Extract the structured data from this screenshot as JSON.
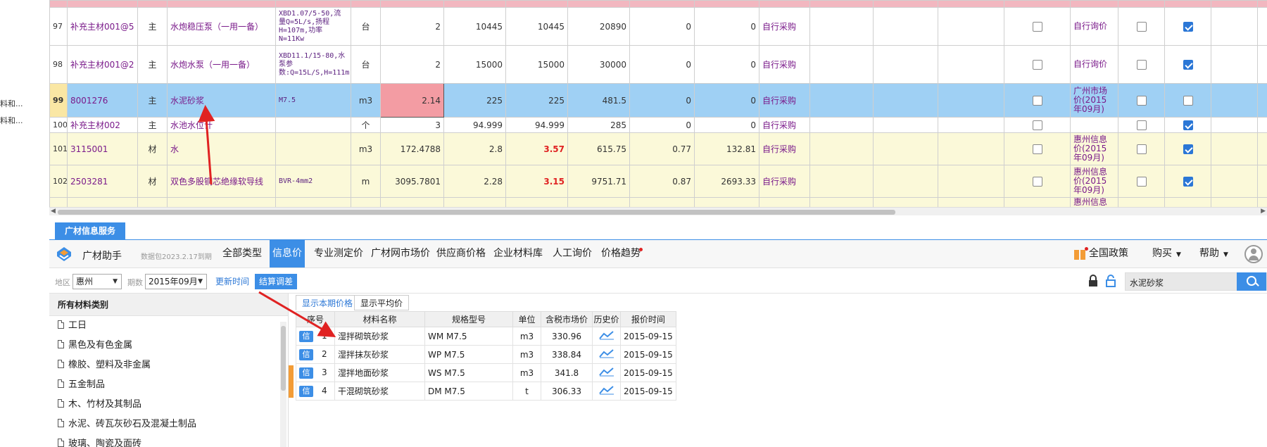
{
  "left_strip": {
    "items": [
      "料和...",
      "料和..."
    ]
  },
  "grid": {
    "rows": [
      {
        "no": "97",
        "code": "补充主材001@5",
        "type": "主",
        "name": "水炮稳压泵（一用一备）",
        "spec": "XBD1.07/5-50,流量Q=5L/s,扬程H=107m,功率N=11Kw",
        "unit": "台",
        "qty": "2",
        "p1": "10445",
        "p2": "10445",
        "amount": "20890",
        "d1": "0",
        "d2": "0",
        "purchase": "自行采购",
        "source": "自行询价",
        "c1": false,
        "c2": false,
        "c3": true
      },
      {
        "no": "98",
        "code": "补充主材001@2",
        "type": "主",
        "name": "水炮水泵（一用一备）",
        "spec": "XBD11.1/15-80,水泵参数:Q=15L/S,H=111m,N=30Kw",
        "unit": "台",
        "qty": "2",
        "p1": "15000",
        "p2": "15000",
        "amount": "30000",
        "d1": "0",
        "d2": "0",
        "purchase": "自行采购",
        "source": "自行询价",
        "c1": false,
        "c2": false,
        "c3": true
      },
      {
        "no": "99",
        "code": "8001276",
        "type": "主",
        "name": "水泥砂浆",
        "spec": "M7.5",
        "unit": "m3",
        "qty": "2.14",
        "p1": "225",
        "p2": "225",
        "amount": "481.5",
        "d1": "0",
        "d2": "0",
        "purchase": "自行采购",
        "source": "广州市场价(2015年09月)",
        "c1": false,
        "c2": false,
        "c3": false
      },
      {
        "no": "100",
        "code": "补充主材002",
        "type": "主",
        "name": "水池水位计",
        "spec": "",
        "unit": "个",
        "qty": "3",
        "p1": "94.999",
        "p2": "94.999",
        "amount": "285",
        "d1": "0",
        "d2": "0",
        "purchase": "自行采购",
        "source": "",
        "c1": false,
        "c2": false,
        "c3": true
      },
      {
        "no": "101",
        "code": "3115001",
        "type": "材",
        "name": "水",
        "spec": "",
        "unit": "m3",
        "qty": "172.4788",
        "p1": "2.8",
        "p2": "3.57",
        "amount": "615.75",
        "d1": "0.77",
        "d2": "132.81",
        "purchase": "自行采购",
        "source": "惠州信息价(2015年09月)",
        "c1": false,
        "c2": false,
        "c3": true
      },
      {
        "no": "102",
        "code": "2503281",
        "type": "材",
        "name": "双色多股铜芯绝缘软导线",
        "spec": "BVR-4mm2",
        "unit": "m",
        "qty": "3095.7801",
        "p1": "2.28",
        "p2": "3.15",
        "amount": "9751.71",
        "d1": "0.87",
        "d2": "2693.33",
        "purchase": "自行采购",
        "source": "惠州信息价(2015年09月)",
        "c1": false,
        "c2": false,
        "c3": true
      },
      {
        "no": "",
        "code": "",
        "type": "",
        "name": "",
        "spec": "",
        "unit": "",
        "qty": "",
        "p1": "",
        "p2": "",
        "amount": "",
        "d1": "",
        "d2": "",
        "purchase": "",
        "source": "惠州信息价",
        "c1": null,
        "c2": null,
        "c3": null
      }
    ]
  },
  "panel": {
    "tab_label": "广材信息服务",
    "brand": "广材助手",
    "version": "数据包2023.2.17到期",
    "nav_tabs": [
      "全部类型",
      "信息价",
      "专业测定价",
      "广材网市场价",
      "供应商价格",
      "企业材料库",
      "人工询价",
      "价格趋势"
    ],
    "active_nav": "信息价",
    "nav_right": {
      "policy": "全国政策",
      "purchase": "购买",
      "help": "帮助"
    },
    "filter": {
      "region_label": "地区",
      "region_value": "惠州",
      "period_label": "期数",
      "period_value": "2015年09月",
      "update_btn": "更新时间",
      "settle_btn": "结算调差",
      "search_value": "水泥砂浆"
    },
    "categories": {
      "header": "所有材料类别",
      "items": [
        "工日",
        "黑色及有色金属",
        "橡胶、塑料及非金属",
        "五金制品",
        "木、竹材及其制品",
        "水泥、砖瓦灰砂石及混凝土制品",
        "玻璃、陶瓷及面砖"
      ]
    },
    "result": {
      "sub_tabs": [
        "显示本期价格",
        "显示平均价"
      ],
      "headers": [
        "序号",
        "材料名称",
        "规格型号",
        "单位",
        "含税市场价",
        "历史价",
        "报价时间"
      ],
      "badge": "信",
      "rows": [
        {
          "no": "1",
          "name": "湿拌砌筑砂浆",
          "spec": "WM M7.5",
          "unit": "m3",
          "price": "330.96",
          "date": "2015-09-15"
        },
        {
          "no": "2",
          "name": "湿拌抹灰砂浆",
          "spec": "WP M7.5",
          "unit": "m3",
          "price": "338.84",
          "date": "2015-09-15"
        },
        {
          "no": "3",
          "name": "湿拌地面砂浆",
          "spec": "WS M7.5",
          "unit": "m3",
          "price": "341.8",
          "date": "2015-09-15"
        },
        {
          "no": "4",
          "name": "干混砌筑砂浆",
          "spec": "DM M7.5",
          "unit": "t",
          "price": "306.33",
          "date": "2015-09-15"
        }
      ]
    }
  },
  "colors": {
    "accent": "#3c8ee6",
    "annotation": "#e02222",
    "selected_row": "#9fd0f4",
    "yellow_row": "#fbf9d9"
  }
}
